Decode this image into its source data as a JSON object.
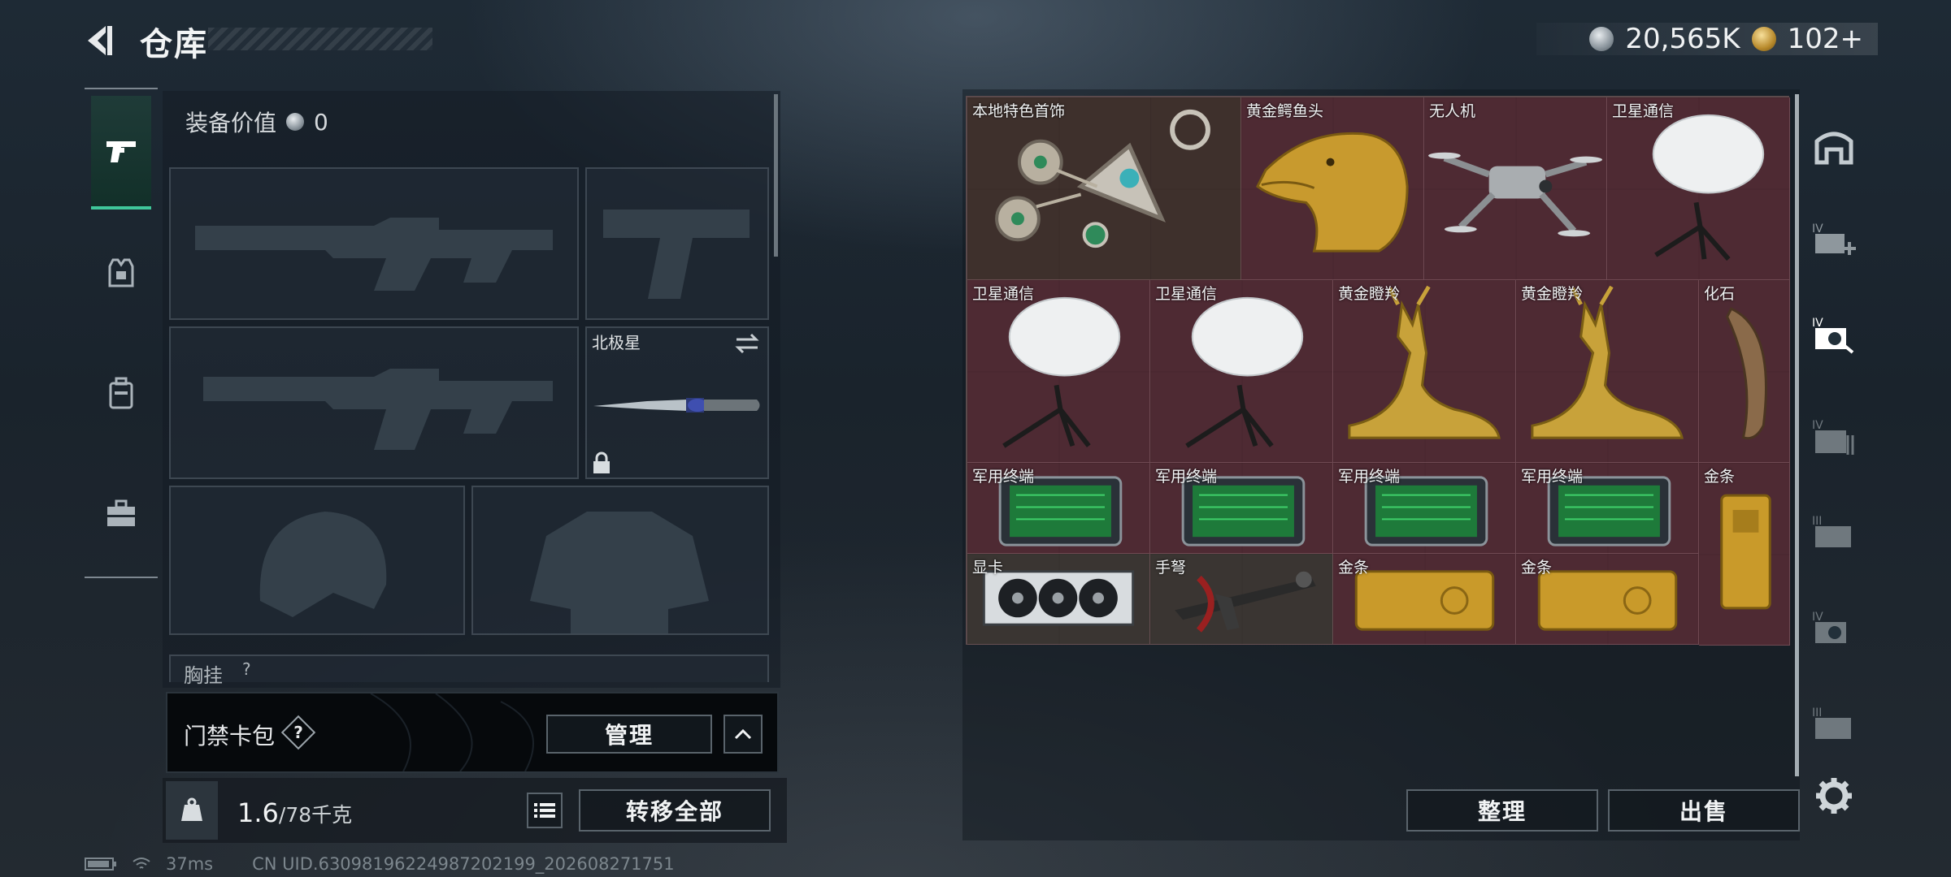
{
  "header": {
    "title": "仓库"
  },
  "currency": {
    "silver": "20,565K",
    "gold": "102+"
  },
  "loadout": {
    "equip_value_label": "装备价值",
    "equip_value": "0",
    "secondary_weapon": "北极星",
    "chest_rig_label": "胸挂",
    "chest_rig_help": "?"
  },
  "keycard": {
    "label": "门禁卡包",
    "help": "?",
    "manage": "管理",
    "expand": "^"
  },
  "weight": {
    "current": "1.6",
    "max": "/78千克"
  },
  "actions": {
    "transfer_all": "转移全部",
    "organize": "整理",
    "sell": "出售"
  },
  "status": {
    "ping": "37ms",
    "uid": "CN UID.630981962249872021​99_202608271751"
  },
  "stash_items": [
    {
      "label": "本地特色首饰",
      "icon": "jewelry-icon"
    },
    {
      "label": "黄金鳄鱼头",
      "icon": "golden-crocodile-head-icon"
    },
    {
      "label": "无人机",
      "icon": "drone-icon"
    },
    {
      "label": "卫星通信",
      "icon": "satellite-dish-icon"
    },
    {
      "label": "卫星通信",
      "icon": "satellite-dish-icon"
    },
    {
      "label": "卫星通信",
      "icon": "satellite-dish-icon"
    },
    {
      "label": "黄金瞪羚",
      "icon": "golden-gazelle-icon"
    },
    {
      "label": "黄金瞪羚",
      "icon": "golden-gazelle-icon"
    },
    {
      "label": "化石",
      "icon": "fossil-claw-icon"
    },
    {
      "label": "军用终端",
      "icon": "military-terminal-icon"
    },
    {
      "label": "军用终端",
      "icon": "military-terminal-icon"
    },
    {
      "label": "军用终端",
      "icon": "military-terminal-icon"
    },
    {
      "label": "军用终端",
      "icon": "military-terminal-icon"
    },
    {
      "label": "金条",
      "icon": "gold-bar-icon"
    },
    {
      "label": "显卡",
      "icon": "graphics-card-icon"
    },
    {
      "label": "手弩",
      "icon": "hand-crossbow-icon"
    },
    {
      "label": "金条",
      "icon": "gold-bar-icon"
    },
    {
      "label": "金条",
      "icon": "gold-bar-icon"
    }
  ]
}
